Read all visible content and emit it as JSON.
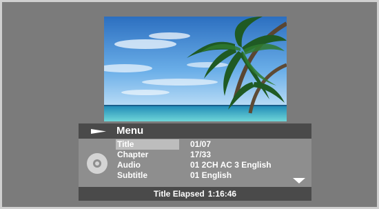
{
  "menu": {
    "title": "Menu",
    "icon": "play-icon",
    "rows": [
      {
        "label": "Title",
        "value": "01/07",
        "selected": true
      },
      {
        "label": "Chapter",
        "value": "17/33",
        "selected": false
      },
      {
        "label": "Audio",
        "value": "01 2CH AC 3 English",
        "selected": false
      },
      {
        "label": "Subtitle",
        "value": "01 English",
        "selected": false
      }
    ],
    "disc_icon": "disc-icon",
    "scroll_icon": "chevron-down-icon"
  },
  "footer": {
    "elapsed_label": "Title Elapsed",
    "elapsed_time": "1:16:46"
  },
  "colors": {
    "screen_bg": "#7b7b7b",
    "bar_bg": "#4a4a4a",
    "panel_bg": "#8e8e8e",
    "highlight": "#bdbdbd",
    "text": "#ffffff"
  }
}
